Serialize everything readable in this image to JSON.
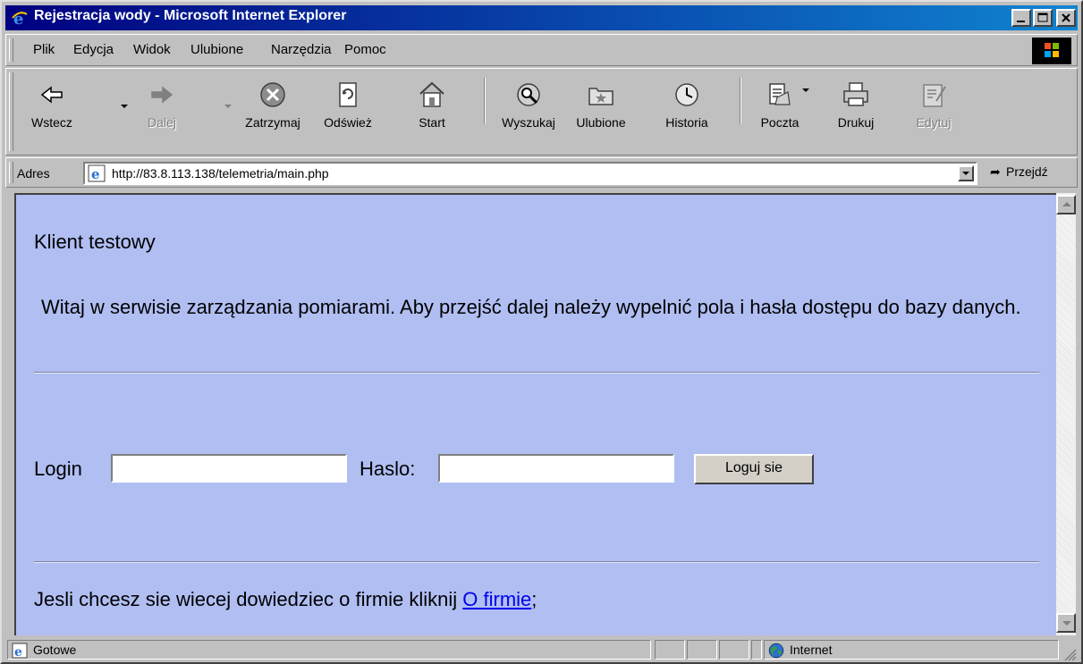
{
  "window": {
    "title": "Rejestracja wody - Microsoft Internet Explorer"
  },
  "menu": {
    "items": [
      "Plik",
      "Edycja",
      "Widok",
      "Ulubione",
      "Narzędzia",
      "Pomoc"
    ]
  },
  "toolbar": {
    "back": "Wstecz",
    "forward": "Dalej",
    "stop": "Zatrzymaj",
    "refresh": "Odśwież",
    "home": "Start",
    "search": "Wyszukaj",
    "favorites": "Ulubione",
    "history": "Historia",
    "mail": "Poczta",
    "print": "Drukuj",
    "edit": "Edytuj"
  },
  "address": {
    "label": "Adres",
    "url": "http://83.8.113.138/telemetria/main.php",
    "go": "Przejdź"
  },
  "page": {
    "title": "Klient testowy",
    "welcome": "Witaj w serwisie zarządzania pomiarami. Aby przejść dalej należy wypelnić pola i hasła dostępu do bazy danych.",
    "login_label": "Login",
    "password_label": "Haslo:",
    "login_value": "",
    "password_value": "",
    "login_button": "Loguj sie",
    "about_text": "Jesli chcesz sie wiecej dowiedziec o firmie kliknij",
    "about_link": "O firmie",
    "about_suffix": ";"
  },
  "status": {
    "text": "Gotowe",
    "zone": "Internet"
  },
  "colors": {
    "page_background": "#b0bef2",
    "title_bar": "#000080",
    "link": "#0000ee"
  }
}
